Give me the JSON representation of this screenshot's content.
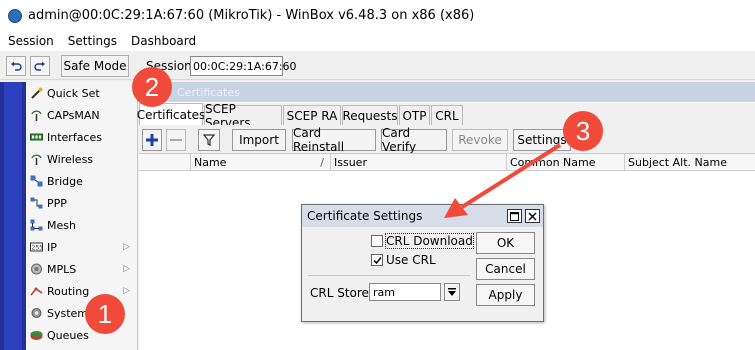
{
  "window": {
    "title": "admin@00:0C:29:1A:67:60 (MikroTik) - WinBox v6.48.3 on x86 (x86)"
  },
  "menu": [
    "Session",
    "Settings",
    "Dashboard"
  ],
  "toolbar": {
    "undo_icon": "undo-icon",
    "redo_icon": "redo-icon",
    "safe_mode_label": "Safe Mode",
    "session_label": "Session:",
    "session_value": "00:0C:29:1A:67:60"
  },
  "sidebar": {
    "items": [
      {
        "label": "Quick Set",
        "icon": "wand-icon",
        "submenu": false
      },
      {
        "label": "CAPsMAN",
        "icon": "antenna-icon",
        "submenu": false
      },
      {
        "label": "Interfaces",
        "icon": "interfaces-icon",
        "submenu": false
      },
      {
        "label": "Wireless",
        "icon": "wireless-icon",
        "submenu": false
      },
      {
        "label": "Bridge",
        "icon": "bridge-icon",
        "submenu": false
      },
      {
        "label": "PPP",
        "icon": "ppp-icon",
        "submenu": false
      },
      {
        "label": "Mesh",
        "icon": "mesh-icon",
        "submenu": false
      },
      {
        "label": "IP",
        "icon": "ip-icon",
        "submenu": true
      },
      {
        "label": "MPLS",
        "icon": "mpls-icon",
        "submenu": true
      },
      {
        "label": "Routing",
        "icon": "routing-icon",
        "submenu": true
      },
      {
        "label": "System",
        "icon": "gear-icon",
        "submenu": false
      },
      {
        "label": "Queues",
        "icon": "queues-icon",
        "submenu": false
      }
    ]
  },
  "certificates_window": {
    "title": "Certificates",
    "tabs": [
      "Certificates",
      "SCEP Servers",
      "SCEP RA",
      "Requests",
      "OTP",
      "CRL"
    ],
    "actions": {
      "add_icon": "plus-icon",
      "remove_icon": "minus-icon",
      "filter_icon": "filter-icon",
      "import": "Import",
      "card_reinstall": "Card Reinstall",
      "card_verify": "Card Verify",
      "revoke": "Revoke",
      "settings": "Settings"
    },
    "columns": [
      "Name",
      "Issuer",
      "Common Name",
      "Subject Alt. Name"
    ],
    "sort_indicator": "/"
  },
  "dialog": {
    "title": "Certificate Settings",
    "crl_download_label": "CRL Download",
    "crl_download_checked": false,
    "use_crl_label": "Use CRL",
    "use_crl_checked": true,
    "crl_store_label": "CRL Store:",
    "crl_store_value": "ram",
    "ok_label": "OK",
    "cancel_label": "Cancel",
    "apply_label": "Apply"
  },
  "annotations": {
    "step1": "1",
    "step2": "2",
    "step3": "3",
    "badge_color": "#f04b3a"
  }
}
